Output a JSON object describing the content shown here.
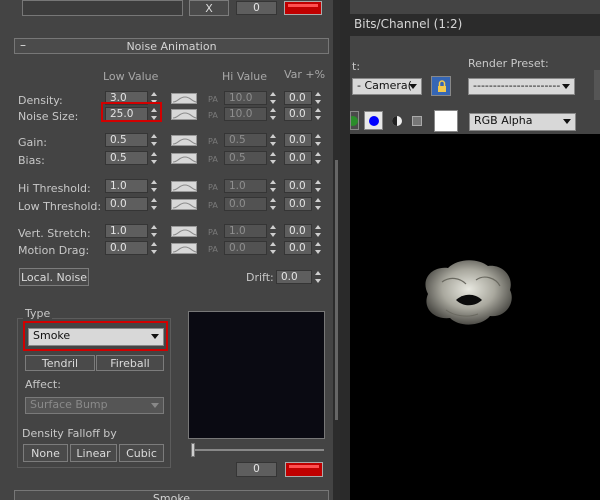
{
  "top": {
    "close_label": "X",
    "top_value": "0"
  },
  "noise_animation": {
    "title": "Noise Animation",
    "collapse_symbol": "–",
    "col_low": "Low Value",
    "col_hi": "Hi Value",
    "col_var": "Var +%",
    "pa_text": "PA",
    "rows": [
      {
        "label": "Density:",
        "low": "3.0",
        "hi": "10.0",
        "var": "0.0"
      },
      {
        "label": "Noise Size:",
        "low": "25.0",
        "hi": "10.0",
        "var": "0.0"
      },
      {
        "label": "Gain:",
        "low": "0.5",
        "hi": "0.5",
        "var": "0.0"
      },
      {
        "label": "Bias:",
        "low": "0.5",
        "hi": "0.5",
        "var": "0.0"
      },
      {
        "label": "Hi Threshold:",
        "low": "1.0",
        "hi": "1.0",
        "var": "0.0"
      },
      {
        "label": "Low Threshold:",
        "low": "0.0",
        "hi": "0.0",
        "var": "0.0"
      },
      {
        "label": "Vert. Stretch:",
        "low": "1.0",
        "hi": "1.0",
        "var": "0.0"
      },
      {
        "label": "Motion Drag:",
        "low": "0.0",
        "hi": "0.0",
        "var": "0.0"
      }
    ],
    "local_noise_label": "Local. Noise",
    "drift_label": "Drift:",
    "drift_value": "0.0"
  },
  "type_group": {
    "title": "Type",
    "selected": "Smoke",
    "tendril_label": "Tendril",
    "fireball_label": "Fireball",
    "affect_label": "Affect:",
    "affect_value": "Surface Bump",
    "falloff_label": "Density Falloff by",
    "falloff_options": [
      "None",
      "Linear",
      "Cubic"
    ]
  },
  "preview": {
    "frame_value": "0"
  },
  "bottom": {
    "next_rollout": "Smoke"
  },
  "right": {
    "viewport_title": "Bits/Channel (1:2)",
    "camera_label": "t:",
    "camera_value": "- Camera(",
    "render_preset_label": "Render Preset:",
    "render_preset_value": "----------------------",
    "channel_value": "RGB Alpha"
  },
  "colors": {
    "highlight_red": "#d10000",
    "blue_dot": "#0000ff"
  }
}
